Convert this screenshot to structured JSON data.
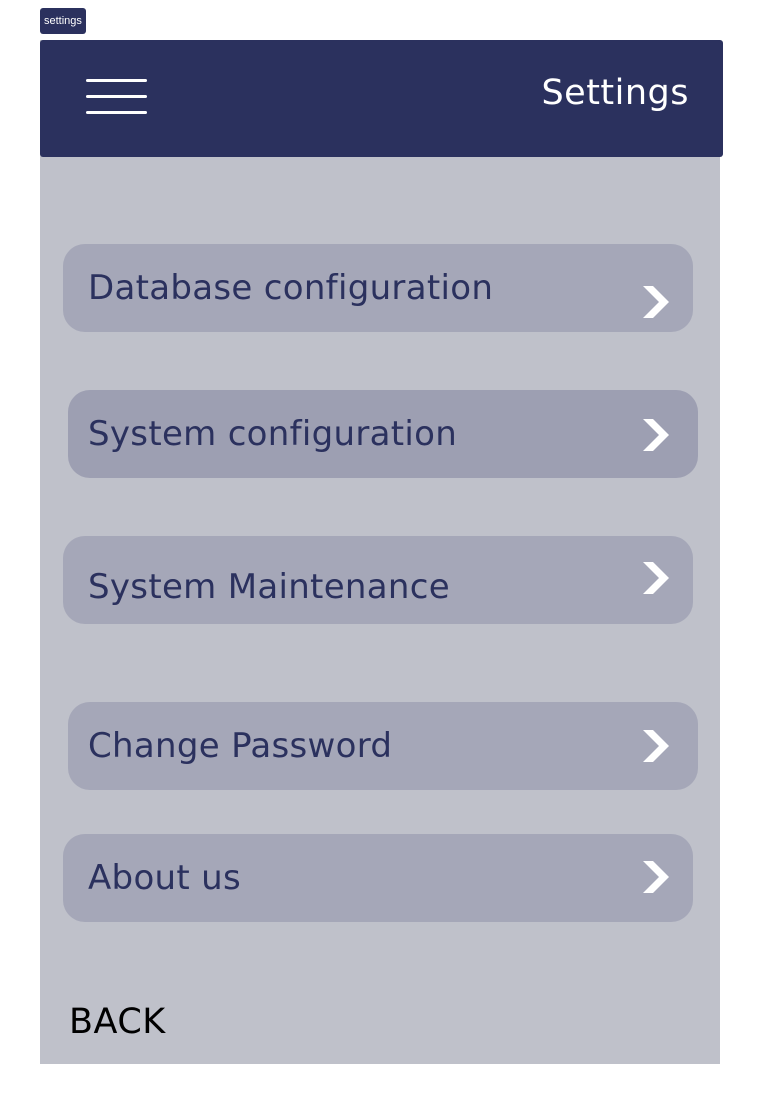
{
  "frame_tag": "settings",
  "header": {
    "menu_icon": "hamburger-menu-icon",
    "title": "Settings"
  },
  "menu": {
    "items": [
      {
        "label": "Database configuration",
        "icon": "chevron-right-icon"
      },
      {
        "label": "System configuration",
        "icon": "chevron-right-icon"
      },
      {
        "label": "System Maintenance",
        "icon": "chevron-right-icon"
      },
      {
        "label": "Change Password",
        "icon": "chevron-right-icon"
      },
      {
        "label": "About us",
        "icon": "chevron-right-icon"
      }
    ]
  },
  "footer": {
    "back_label": "BACK"
  },
  "colors": {
    "header_bg": "#2b315e",
    "screen_bg": "#bfc1ca",
    "item_bg": "#a5a7b8",
    "item_text": "#2b315e",
    "chevron": "#ffffff"
  }
}
